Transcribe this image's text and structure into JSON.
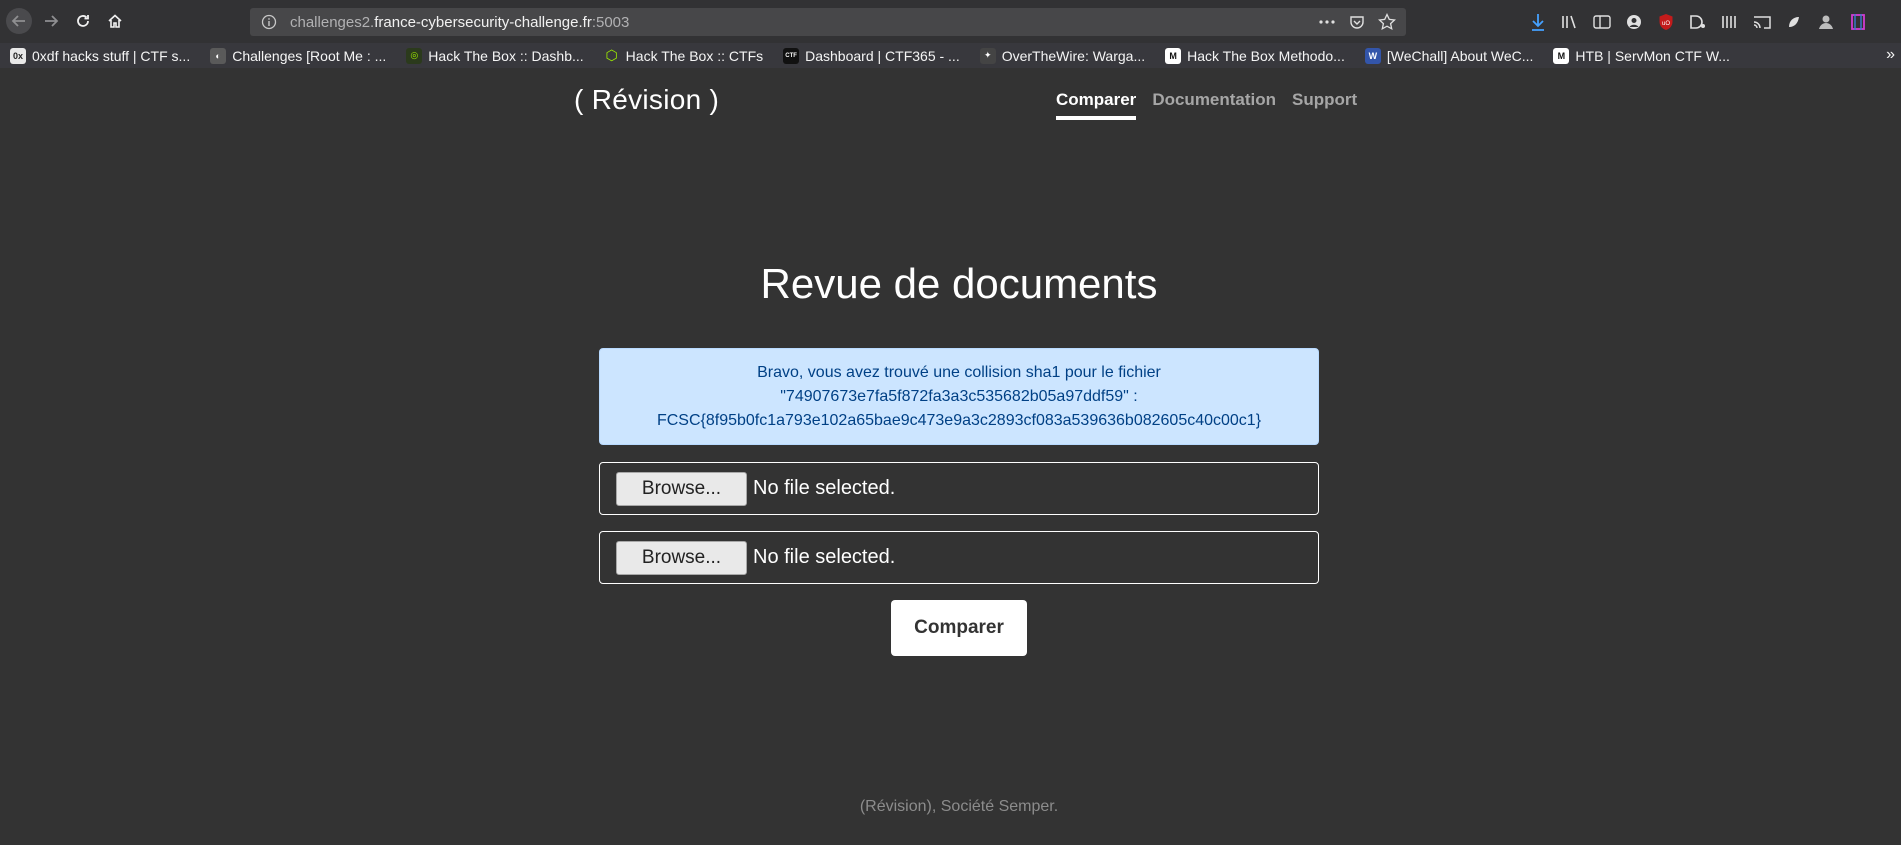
{
  "browser": {
    "url_prefix": "challenges2.",
    "url_domain": "france-cybersecurity-challenge.fr",
    "url_port": ":5003",
    "bookmarks": [
      {
        "label": "0xdf hacks stuff | CTF s...",
        "color": "#e8e8e8",
        "glyph": "0x"
      },
      {
        "label": "Challenges [Root Me : ...",
        "color": "#5a5a5a",
        "glyph": "◐"
      },
      {
        "label": "Hack The Box :: Dashb...",
        "color": "#2b3a1c",
        "glyph": "◎"
      },
      {
        "label": "Hack The Box :: CTFs",
        "color": "#9fef00",
        "glyph": "⬡"
      },
      {
        "label": "Dashboard | CTF365 - ...",
        "color": "#111111",
        "glyph": "CTF"
      },
      {
        "label": "OverTheWire: Warga...",
        "color": "#444444",
        "glyph": "✦"
      },
      {
        "label": "Hack The Box Methodo...",
        "color": "#ffffff",
        "glyph": "M"
      },
      {
        "label": "[WeChall] About WeC...",
        "color": "#3355aa",
        "glyph": "W"
      },
      {
        "label": "HTB | ServMon CTF W...",
        "color": "#ffffff",
        "glyph": "M"
      }
    ]
  },
  "brand": "( Révision )",
  "nav": [
    {
      "label": "Comparer",
      "active": true
    },
    {
      "label": "Documentation",
      "active": false
    },
    {
      "label": "Support",
      "active": false
    }
  ],
  "heading": "Revue de documents",
  "alert": {
    "line1": "Bravo, vous avez trouvé une collision sha1 pour le fichier",
    "line2": "\"74907673e7fa5f872fa3a3c535682b05a97ddf59\" :",
    "line3": "FCSC{8f95b0fc1a793e102a65bae9c473e9a3c2893cf083a539636b082605c40c00c1}"
  },
  "file_inputs": [
    {
      "button": "Browse...",
      "status": "No file selected."
    },
    {
      "button": "Browse...",
      "status": "No file selected."
    }
  ],
  "submit_label": "Comparer",
  "footer": "(Révision), Société Semper.",
  "colors": {
    "page_bg": "#333333",
    "alert_bg": "#cce5ff",
    "alert_text": "#004085",
    "download_icon": "#45a1ff"
  }
}
